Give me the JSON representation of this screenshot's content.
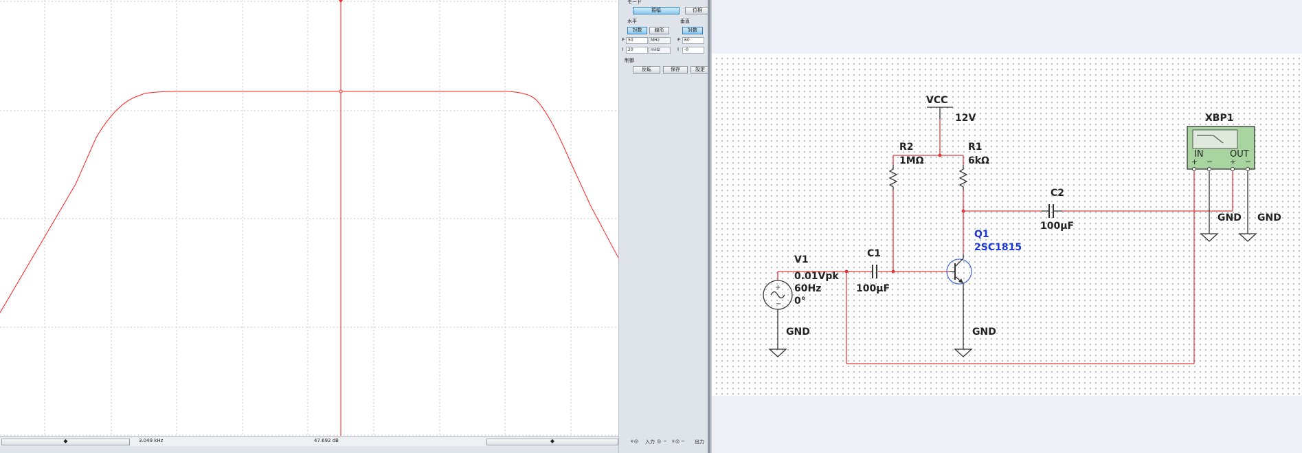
{
  "plotter": {
    "statusbar": {
      "left_arrow": "◆",
      "frequency": "3.049 kHz",
      "magnitude": "47.692 dB",
      "right_arrow": "◆"
    },
    "controls": {
      "mode_label": "モード",
      "mode_buttons": [
        "振幅",
        "位相"
      ],
      "horizontal_label": "水平",
      "vertical_label": "垂直",
      "h_scale_buttons": [
        "対数",
        "線形"
      ],
      "v_scale_button": "対数",
      "h_final": {
        "prefix": "F",
        "value": "50",
        "unit": "MHz"
      },
      "h_initial": {
        "prefix": "I",
        "value": "20",
        "unit": "mHz"
      },
      "v_final": {
        "prefix": "F",
        "value": "60"
      },
      "v_initial": {
        "prefix": "I",
        "value": "-0"
      },
      "control_label": "制御",
      "control_buttons": [
        "反転",
        "保存",
        "設定"
      ],
      "bottom_labels": {
        "plus1": "+",
        "minus1": "−",
        "input": "入力",
        "plus2": "+",
        "minus2": "−",
        "output": "出力"
      }
    }
  },
  "schematic": {
    "vcc": {
      "name": "VCC",
      "value": "12V"
    },
    "r1": {
      "name": "R1",
      "value": "6kΩ"
    },
    "r2": {
      "name": "R2",
      "value": "1MΩ"
    },
    "c1": {
      "name": "C1",
      "value": "100μF"
    },
    "c2": {
      "name": "C2",
      "value": "100μF"
    },
    "q1": {
      "name": "Q1",
      "part": "2SC1815"
    },
    "v1": {
      "name": "V1",
      "amplitude": "0.01Vpk",
      "frequency": "60Hz",
      "phase": "0°"
    },
    "xbp1": {
      "name": "XBP1",
      "in_label": "IN",
      "out_label": "OUT",
      "pins": [
        "+",
        "−",
        "+",
        "−"
      ]
    },
    "gnd_label": "GND",
    "colors": {
      "wire": "#e23b3b",
      "component": "#333333",
      "transistor_label": "#1c35d6",
      "plotter_trace": "#ff2020",
      "bode_body": "#a8d4a0"
    }
  }
}
